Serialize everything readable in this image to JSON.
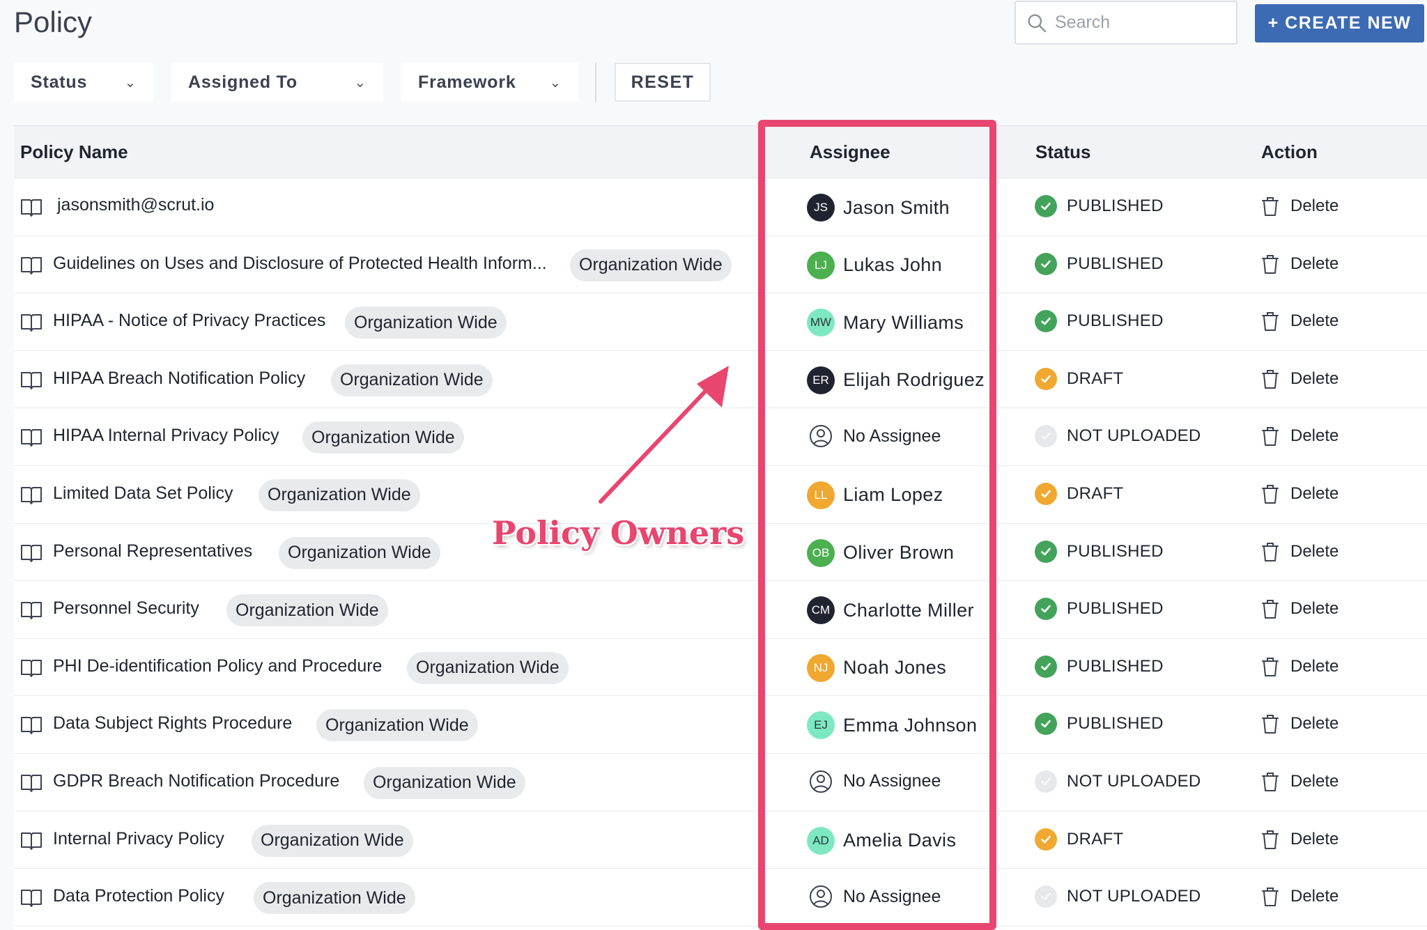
{
  "header": {
    "title": "Policy",
    "search_placeholder": "Search",
    "create_label": "+ CREATE NEW"
  },
  "filters": {
    "status": "Status",
    "assigned_to": "Assigned To",
    "framework": "Framework",
    "reset": "RESET"
  },
  "table": {
    "headers": {
      "name": "Policy Name",
      "assignee": "Assignee",
      "status": "Status",
      "action": "Action"
    },
    "rows": [
      {
        "name": "jasonsmith@scrut.io",
        "tag": "",
        "initials": "JS",
        "assignee": "Jason Smith",
        "avatar_color": "#1f2430",
        "status": "PUBLISHED",
        "status_kind": "published",
        "action": "Delete"
      },
      {
        "name": "Guidelines on Uses and Disclosure of Protected Health Inform...",
        "tag": "Organization Wide",
        "initials": "LJ",
        "assignee": "Lukas John",
        "avatar_color": "#4caf50",
        "status": "PUBLISHED",
        "status_kind": "published",
        "action": "Delete"
      },
      {
        "name": "HIPAA - Notice of Privacy Practices",
        "tag": "Organization Wide",
        "initials": "MW",
        "assignee": "Mary Williams",
        "avatar_color": "#7ee8c3",
        "status": "PUBLISHED",
        "status_kind": "published",
        "action": "Delete"
      },
      {
        "name": "HIPAA Breach Notification Policy",
        "tag": "Organization Wide",
        "initials": "ER",
        "assignee": "Elijah Rodriguez",
        "avatar_color": "#1f2430",
        "status": "DRAFT",
        "status_kind": "draft",
        "action": "Delete"
      },
      {
        "name": "HIPAA Internal Privacy Policy",
        "tag": "Organization Wide",
        "initials": "",
        "assignee": "No Assignee",
        "avatar_color": "",
        "status": "NOT UPLOADED",
        "status_kind": "none",
        "action": "Delete"
      },
      {
        "name": "Limited Data Set Policy",
        "tag": "Organization Wide",
        "initials": "LL",
        "assignee": "Liam Lopez",
        "avatar_color": "#f0a830",
        "status": "DRAFT",
        "status_kind": "draft",
        "action": "Delete"
      },
      {
        "name": "Personal Representatives",
        "tag": "Organization Wide",
        "initials": "OB",
        "assignee": "Oliver Brown",
        "avatar_color": "#4caf50",
        "status": "PUBLISHED",
        "status_kind": "published",
        "action": "Delete"
      },
      {
        "name": "Personnel Security",
        "tag": "Organization Wide",
        "initials": "CM",
        "assignee": "Charlotte Miller",
        "avatar_color": "#1f2430",
        "status": "PUBLISHED",
        "status_kind": "published",
        "action": "Delete"
      },
      {
        "name": "PHI De-identification Policy and Procedure",
        "tag": "Organization Wide",
        "initials": "NJ",
        "assignee": "Noah Jones",
        "avatar_color": "#f0a830",
        "status": "PUBLISHED",
        "status_kind": "published",
        "action": "Delete"
      },
      {
        "name": "Data Subject Rights Procedure",
        "tag": "Organization Wide",
        "initials": "EJ",
        "assignee": "Emma Johnson",
        "avatar_color": "#7ee8c3",
        "status": "PUBLISHED",
        "status_kind": "published",
        "action": "Delete"
      },
      {
        "name": "GDPR Breach Notification Procedure",
        "tag": "Organization Wide",
        "initials": "",
        "assignee": "No Assignee",
        "avatar_color": "",
        "status": "NOT UPLOADED",
        "status_kind": "none",
        "action": "Delete"
      },
      {
        "name": "Internal Privacy Policy",
        "tag": "Organization Wide",
        "initials": "AD",
        "assignee": "Amelia Davis",
        "avatar_color": "#7ee8c3",
        "status": "DRAFT",
        "status_kind": "draft",
        "action": "Delete"
      },
      {
        "name": "Data Protection Policy",
        "tag": "Organization Wide",
        "initials": "",
        "assignee": "No Assignee",
        "avatar_color": "",
        "status": "NOT UPLOADED",
        "status_kind": "none",
        "action": "Delete"
      }
    ]
  },
  "annotation": {
    "label": "Policy Owners",
    "color": "#e8466f"
  },
  "colors": {
    "accent": "#3c6bb4",
    "published": "#43a35a",
    "draft": "#f0a830",
    "not_uploaded": "#e6e8eb"
  }
}
